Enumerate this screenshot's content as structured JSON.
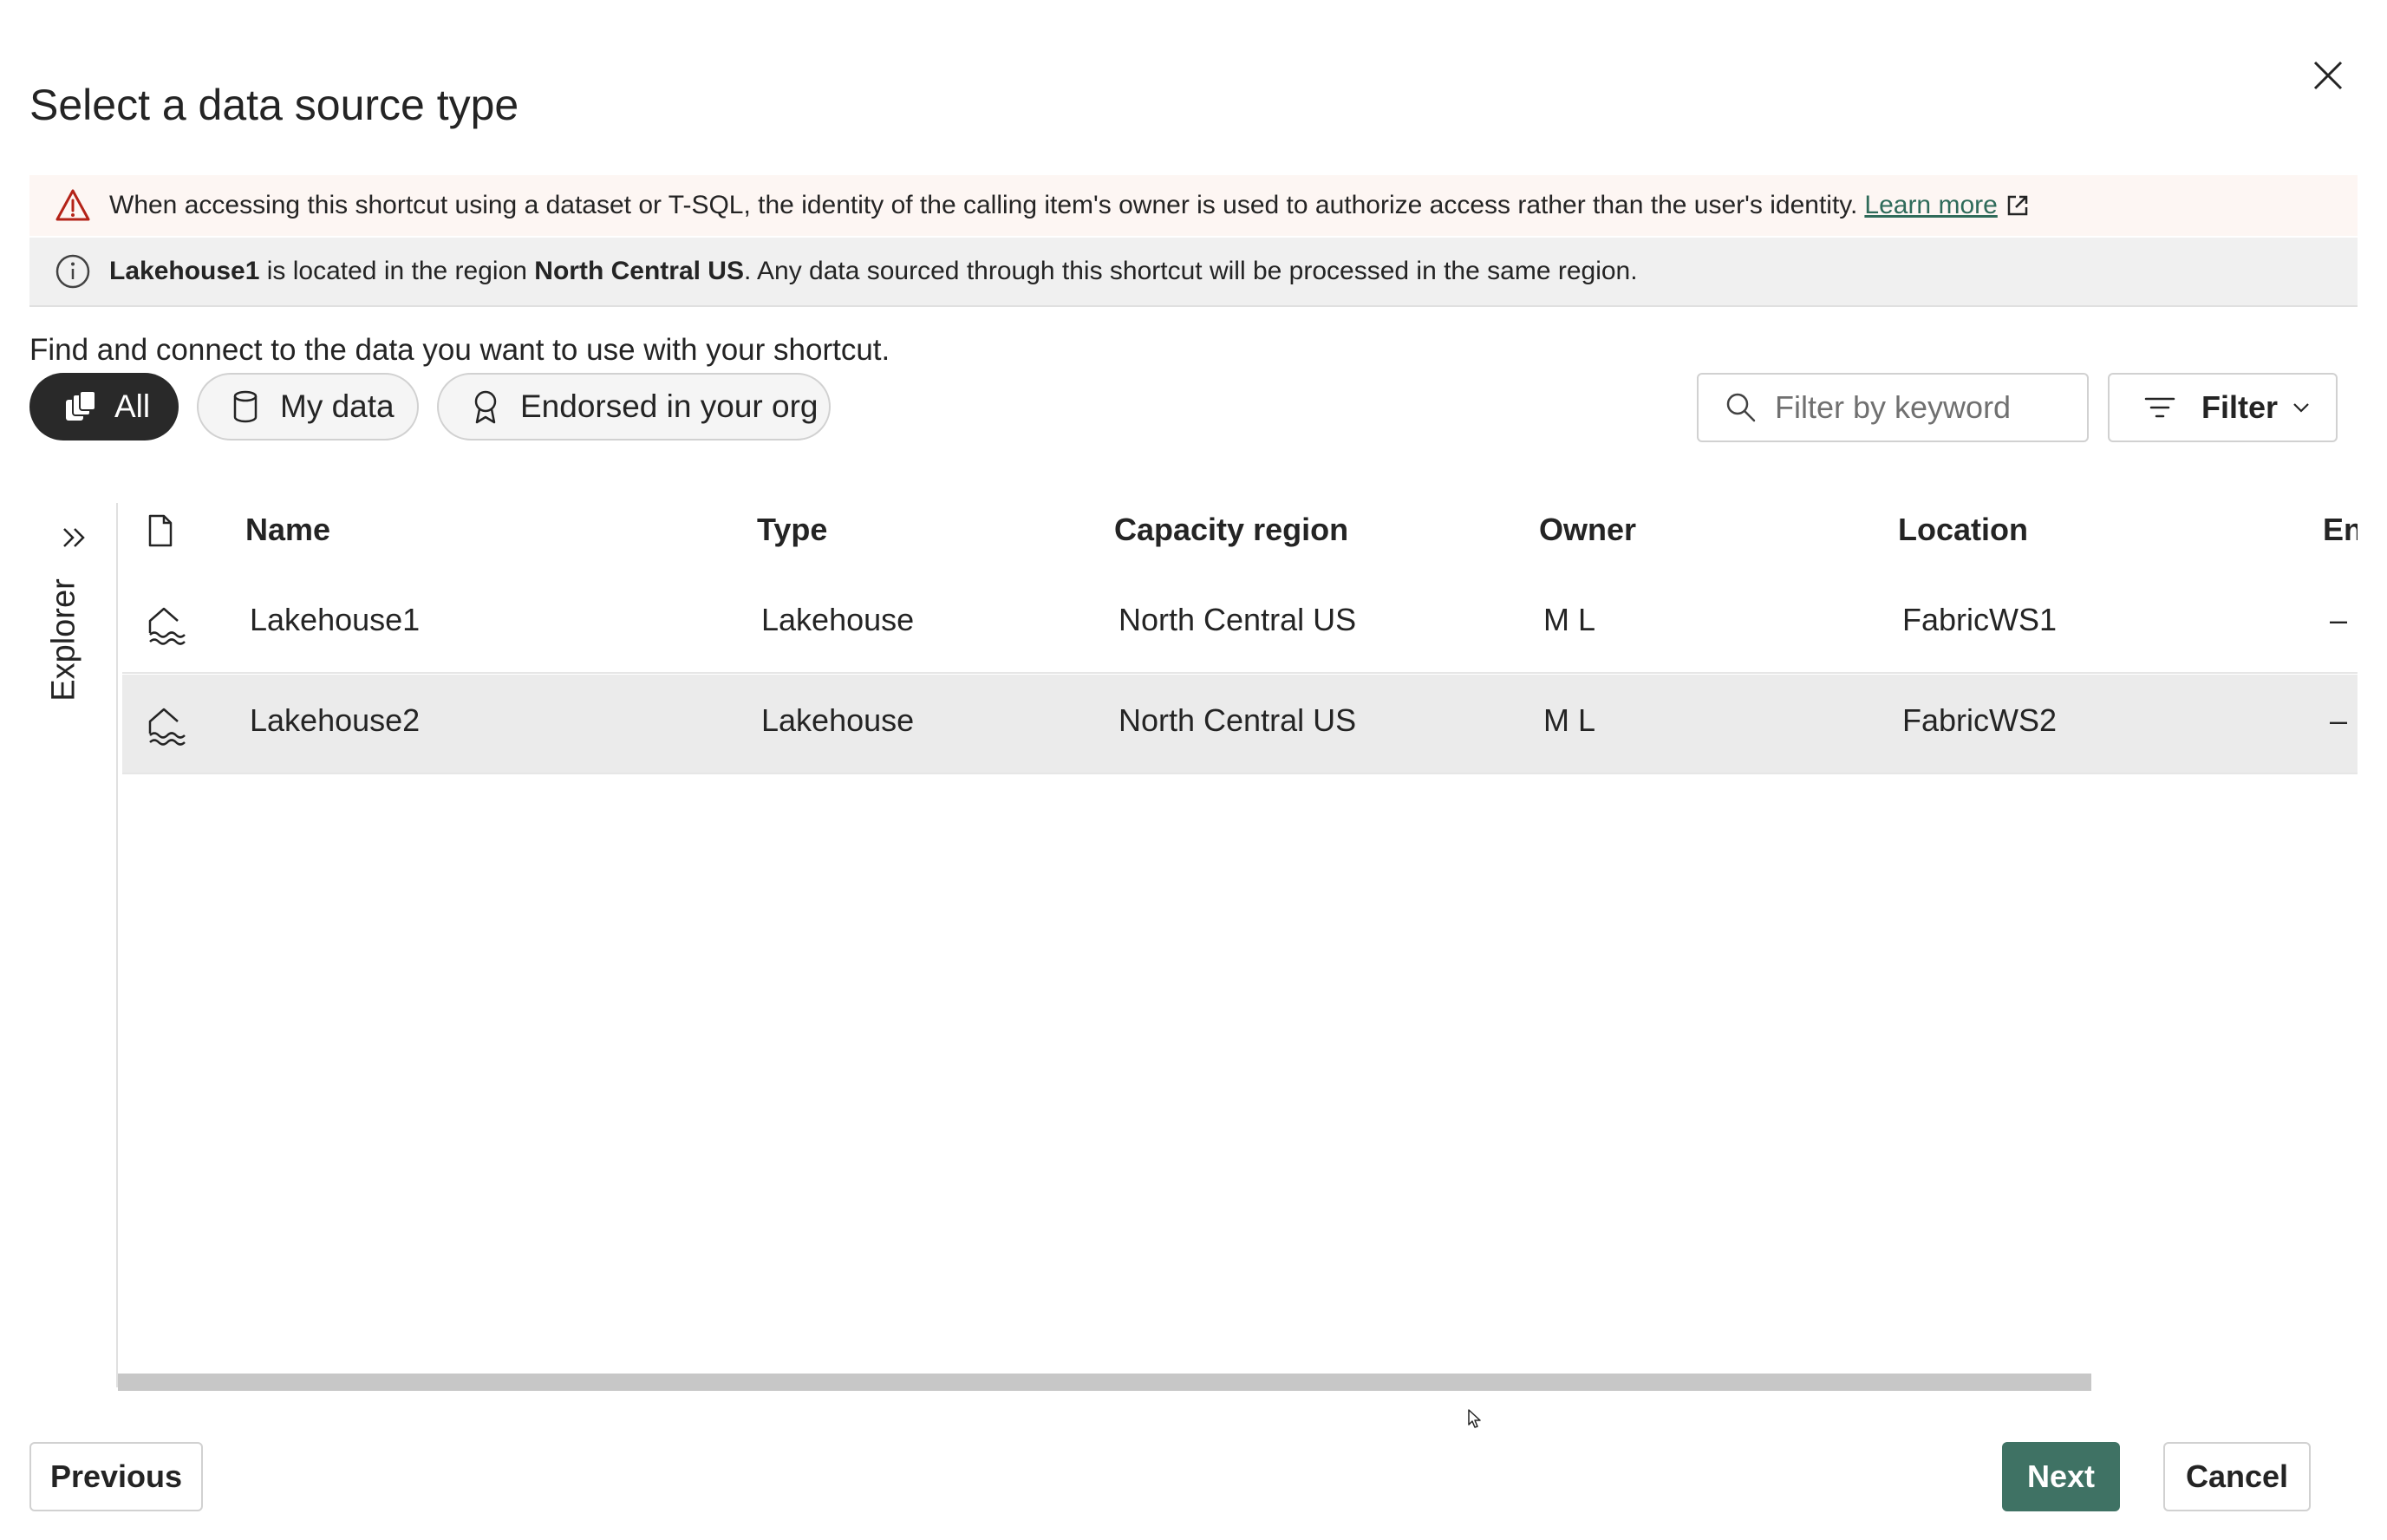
{
  "dialog": {
    "title": "Select a data source type",
    "close_icon": "close-icon"
  },
  "warning_banner": {
    "icon": "warning-icon",
    "text": "When accessing this shortcut using a dataset or T-SQL, the identity of the calling item's owner is used to authorize access rather than the user's identity.",
    "link_label": "Learn more",
    "link_icon": "external-link-icon"
  },
  "info_banner": {
    "icon": "info-icon",
    "item_name": "Lakehouse1",
    "text_1": " is located in the region ",
    "region": "North Central US",
    "text_2": ". Any data sourced through this shortcut will be processed in the same region."
  },
  "subtitle": "Find and connect to the data you want to use with your shortcut.",
  "pills": {
    "all": {
      "label": "All",
      "icon": "all-items-icon",
      "selected": true
    },
    "my_data": {
      "label": "My data",
      "icon": "database-icon"
    },
    "endorsed": {
      "label": "Endorsed in your org",
      "icon": "badge-icon"
    }
  },
  "search": {
    "placeholder": "Filter by keyword",
    "value": "",
    "icon": "search-icon"
  },
  "filter": {
    "label": "Filter",
    "icon": "filter-icon",
    "chevron": "chevron-down-icon"
  },
  "explorer": {
    "label": "Explorer",
    "icon": "double-chevron-right-icon"
  },
  "table": {
    "type_icon_header": "document-icon",
    "columns": [
      "Name",
      "Type",
      "Capacity region",
      "Owner",
      "Location",
      "Enc"
    ],
    "rows": [
      {
        "icon": "lakehouse-icon",
        "name": "Lakehouse1",
        "type": "Lakehouse",
        "region": "North Central US",
        "owner": "M L",
        "location": "FabricWS1",
        "endorsement": "–",
        "selected": false
      },
      {
        "icon": "lakehouse-icon",
        "name": "Lakehouse2",
        "type": "Lakehouse",
        "region": "North Central US",
        "owner": "M L",
        "location": "FabricWS2",
        "endorsement": "–",
        "selected": true
      }
    ]
  },
  "footer": {
    "previous_label": "Previous",
    "next_label": "Next",
    "cancel_label": "Cancel"
  },
  "colors": {
    "primary": "#3f7264",
    "pill_selected": "#292929",
    "warning_bg": "#fdf6f3",
    "info_bg": "#f0f0f0",
    "warning_icon": "#b42318",
    "link": "#2f6b5a"
  }
}
